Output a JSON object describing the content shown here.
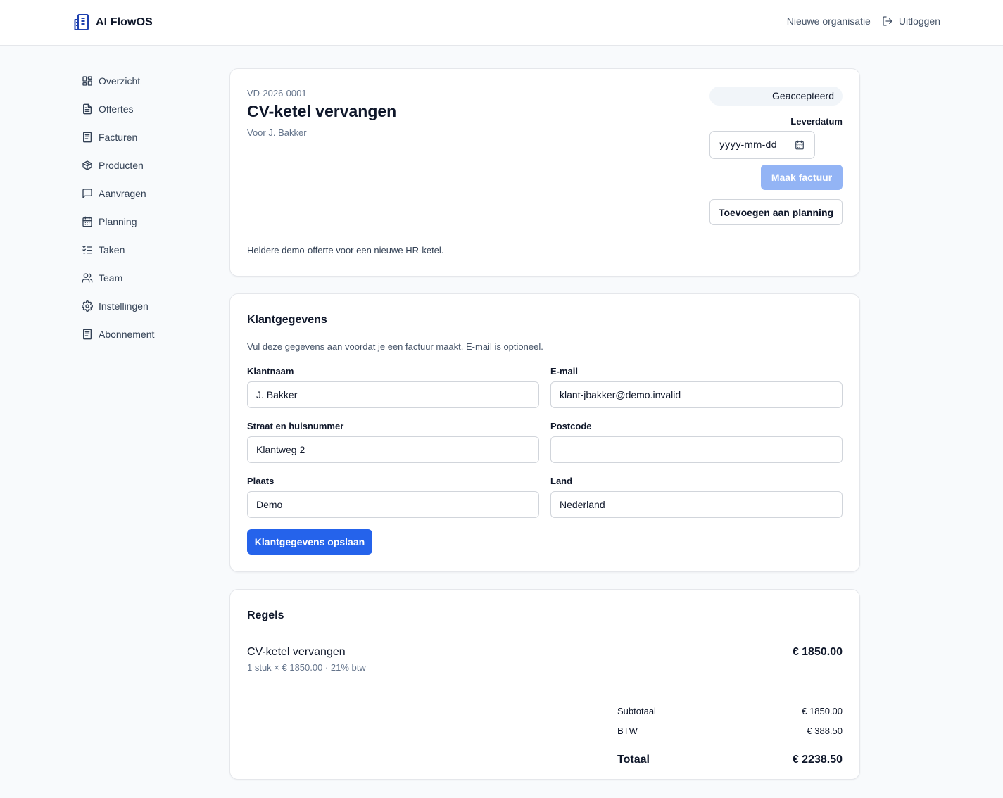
{
  "app": {
    "name": "AI FlowOS"
  },
  "header": {
    "new_org": "Nieuwe organisatie",
    "logout": "Uitloggen"
  },
  "sidebar": {
    "items": [
      {
        "label": "Overzicht",
        "icon": "grid-icon"
      },
      {
        "label": "Offertes",
        "icon": "file-text-icon"
      },
      {
        "label": "Facturen",
        "icon": "receipt-icon"
      },
      {
        "label": "Producten",
        "icon": "package-icon"
      },
      {
        "label": "Aanvragen",
        "icon": "message-icon"
      },
      {
        "label": "Planning",
        "icon": "calendar-icon"
      },
      {
        "label": "Taken",
        "icon": "list-checks-icon"
      },
      {
        "label": "Team",
        "icon": "users-icon"
      },
      {
        "label": "Instellingen",
        "icon": "gear-icon"
      },
      {
        "label": "Abonnement",
        "icon": "receipt-icon"
      }
    ]
  },
  "quote": {
    "number": "VD-2026-0001",
    "title": "CV-ketel vervangen",
    "for": "Voor J. Bakker",
    "description": "Heldere demo-offerte voor een nieuwe HR-ketel.",
    "status": "Geaccepteerd",
    "delivery_label": "Leverdatum",
    "delivery_placeholder": "yyyy-mm-dd",
    "make_invoice": "Maak factuur",
    "add_to_planning": "Toevoegen aan planning"
  },
  "customer": {
    "title": "Klantgegevens",
    "hint": "Vul deze gegevens aan voordat je een factuur maakt. E-mail is optioneel.",
    "fields": {
      "name": {
        "label": "Klantnaam",
        "value": "J. Bakker"
      },
      "email": {
        "label": "E-mail",
        "value": "klant-jbakker@demo.invalid"
      },
      "street": {
        "label": "Straat en huisnummer",
        "value": "Klantweg 2"
      },
      "postcode": {
        "label": "Postcode",
        "value": ""
      },
      "city": {
        "label": "Plaats",
        "value": "Demo"
      },
      "country": {
        "label": "Land",
        "value": "Nederland"
      }
    },
    "save_label": "Klantgegevens opslaan"
  },
  "lines": {
    "title": "Regels",
    "items": [
      {
        "name": "CV-ketel vervangen",
        "meta": "1 stuk × € 1850.00 · 21% btw",
        "total": "€ 1850.00"
      }
    ],
    "totals": {
      "subtotal_label": "Subtotaal",
      "subtotal": "€ 1850.00",
      "vat_label": "BTW",
      "vat": "€ 388.50",
      "total_label": "Totaal",
      "total": "€ 2238.50"
    }
  },
  "colors": {
    "primary": "#2563eb",
    "primary_disabled": "#93b4f5",
    "brand_icon": "#1e40af"
  }
}
